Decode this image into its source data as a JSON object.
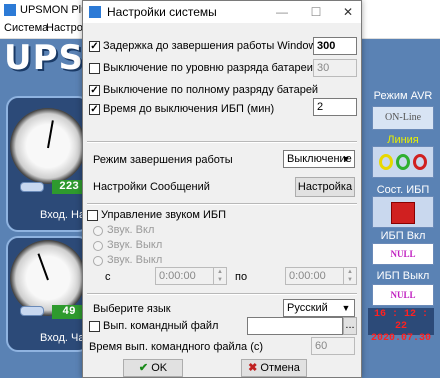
{
  "background_app": {
    "title": "UPSMON Plus for",
    "menu": [
      "Система",
      "Настрой"
    ],
    "logo": "UPSMON",
    "gauge_top_value": "223",
    "gauge_top_label": "Вход. Нап",
    "gauge_bottom_value": "49",
    "gauge_bottom_label": "Вход. Час",
    "right_panel": {
      "avr_label": "Режим AVR",
      "avr_status": "ON-Line",
      "line_label": "Линия",
      "ups_state_label": "Сост. ИБП",
      "ups_on_label": "ИБП Вкл",
      "ups_on_value": "NULL",
      "ups_off_label": "ИБП Выкл",
      "ups_off_value": "NULL",
      "time": "16 : 12 : 22",
      "date": "2020.07.30"
    }
  },
  "dialog": {
    "title": "Настройки системы",
    "window_controls": [
      "—",
      "☐",
      "✕"
    ],
    "delay_shutdown": {
      "label": "Задержка до завершения работы Windows,с",
      "checked": true,
      "value": "300"
    },
    "battery_level": {
      "label": "Выключение по уровню разряда батареи, %",
      "checked": false,
      "value": "30"
    },
    "full_discharge": {
      "label": "Выключение по полному разряду батарей",
      "checked": true
    },
    "ups_off_time": {
      "label": "Время до выключения ИБП (мин)",
      "checked": true,
      "value": "2"
    },
    "shutdown_mode": {
      "label": "Режим завершения работы",
      "value": "Выключение"
    },
    "messages": {
      "label": "Настройки Сообщений",
      "button": "Настройка"
    },
    "sound": {
      "label": "Управление звуком ИБП",
      "checked": false,
      "options": [
        "Звук. Вкл",
        "Звук. Выкл",
        "Звук. Выкл"
      ],
      "from_label": "с",
      "to_label": "по",
      "from_time": "0:00:00",
      "to_time": "0:00:00"
    },
    "language": {
      "label": "Выберите язык",
      "value": "Русский"
    },
    "command_file": {
      "label": "Вып. командный файл",
      "checked": false,
      "path": "",
      "browse": "..."
    },
    "command_time": {
      "label": "Время вып. командного файла (с)",
      "value": "60"
    },
    "ok_label": "OK",
    "cancel_label": "Отмена"
  }
}
